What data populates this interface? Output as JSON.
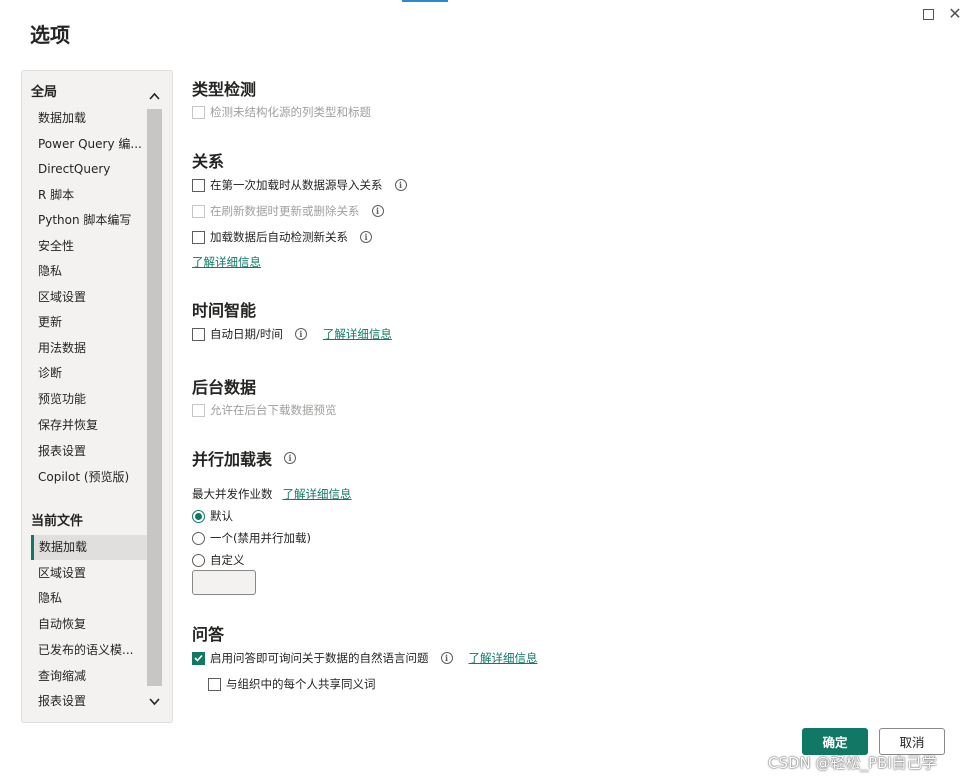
{
  "dialog": {
    "title": "选项"
  },
  "window": {
    "maximize_label": "□",
    "close_label": "✕"
  },
  "sidebar": {
    "global_heading": "全局",
    "global_items": [
      "数据加载",
      "Power Query 编...",
      "DirectQuery",
      "R 脚本",
      "Python 脚本编写",
      "安全性",
      "隐私",
      "区域设置",
      "更新",
      "用法数据",
      "诊断",
      "预览功能",
      "保存并恢复",
      "报表设置",
      "Copilot (预览版)"
    ],
    "file_heading": "当前文件",
    "file_items": [
      "数据加载",
      "区域设置",
      "隐私",
      "自动恢复",
      "已发布的语义模...",
      "查询缩减",
      "报表设置"
    ],
    "selected_file_item": "数据加载"
  },
  "type_detection": {
    "title": "类型检测",
    "detect_types_label": "检测未结构化源的列类型和标题"
  },
  "relationships": {
    "title": "关系",
    "import_label": "在第一次加载时从数据源导入关系",
    "update_label": "在刷新数据时更新或删除关系",
    "autodetect_label": "加载数据后自动检测新关系",
    "learn_more": "了解详细信息"
  },
  "time_intelligence": {
    "title": "时间智能",
    "auto_date_label": "自动日期/时间",
    "learn_more": "了解详细信息"
  },
  "background_data": {
    "title": "后台数据",
    "allow_preview_label": "允许在后台下载数据预览"
  },
  "parallel_loading": {
    "title": "并行加载表",
    "max_jobs_label": "最大并发作业数",
    "learn_more": "了解详细信息",
    "option_default": "默认",
    "option_one": "一个(禁用并行加载)",
    "option_custom": "自定义",
    "custom_value": ""
  },
  "qa": {
    "title": "问答",
    "enable_label": "启用问答即可询问关于数据的自然语言问题",
    "learn_more": "了解详细信息",
    "share_synonyms_label": "与组织中的每个人共享同义词"
  },
  "buttons": {
    "ok": "确定",
    "cancel": "取消"
  },
  "watermark": "CSDN @轻松_PBI自己学",
  "icons": {
    "info": "i"
  },
  "colors": {
    "accent": "#117865",
    "sidebar_bg": "#f3f2f1",
    "scrollbar": "#c8c6c4"
  }
}
